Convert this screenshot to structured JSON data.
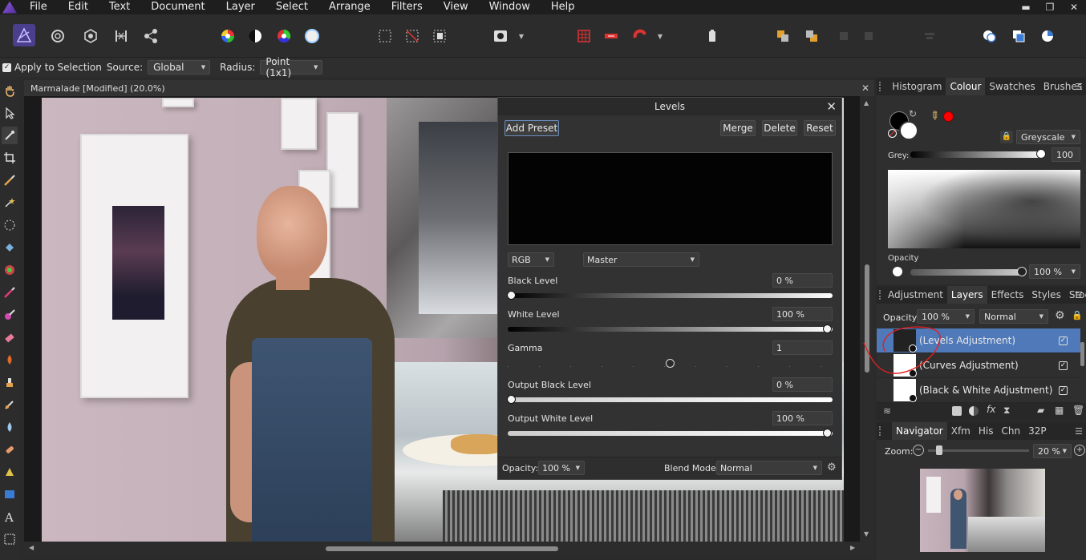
{
  "menu": {
    "items": [
      "File",
      "Edit",
      "Text",
      "Document",
      "Layer",
      "Select",
      "Arrange",
      "Filters",
      "View",
      "Window",
      "Help"
    ],
    "window_controls": {
      "minimize": "▬",
      "restore": "❐",
      "close": "✕"
    }
  },
  "context_bar": {
    "apply_to_selection": "Apply to Selection",
    "source_label": "Source:",
    "source_value": "Global",
    "radius_label": "Radius:",
    "radius_value": "Point (1x1)"
  },
  "document": {
    "title": "Marmalade [Modified] (20.0%)",
    "close": "✕"
  },
  "levels": {
    "title": "Levels",
    "add_preset": "Add Preset",
    "merge": "Merge",
    "delete": "Delete",
    "reset": "Reset",
    "channel": "RGB",
    "mode": "Master",
    "black_level": {
      "label": "Black Level",
      "value": "0 %",
      "fraction": 0.0
    },
    "white_level": {
      "label": "White Level",
      "value": "100 %",
      "fraction": 1.0
    },
    "gamma": {
      "label": "Gamma",
      "value": "1",
      "fraction": 0.5
    },
    "output_black": {
      "label": "Output Black Level",
      "value": "0 %",
      "fraction": 0.0
    },
    "output_white": {
      "label": "Output White Level",
      "value": "100 %",
      "fraction": 1.0
    },
    "opacity_label": "Opacity:",
    "opacity_value": "100 %",
    "blend_label": "Blend Mode:",
    "blend_value": "Normal"
  },
  "colour_panel": {
    "tabs": [
      "Histogram",
      "Colour",
      "Swatches",
      "Brushes"
    ],
    "active_tab": "Colour",
    "model": "Greyscale",
    "grey_label": "Grey:",
    "grey_value": "100",
    "opacity_label": "Opacity",
    "opacity_value": "100 %"
  },
  "layers_panel": {
    "tabs": [
      "Adjustment",
      "Layers",
      "Effects",
      "Styles",
      "Stock"
    ],
    "active_tab": "Layers",
    "opacity_label": "Opacity:",
    "opacity_value": "100 %",
    "blend_value": "Normal",
    "layers": [
      {
        "name": "(Levels Adjustment)",
        "selected": true
      },
      {
        "name": "(Curves Adjustment)",
        "selected": false
      },
      {
        "name": "(Black & White Adjustment)",
        "selected": false
      }
    ]
  },
  "navigator_panel": {
    "tabs": [
      "Navigator",
      "Xfm",
      "His",
      "Chn",
      "32P"
    ],
    "active_tab": "Navigator",
    "zoom_label": "Zoom:",
    "zoom_value": "20 %"
  },
  "colors": {
    "accent": "#4f79b8",
    "annotation": "#e02020",
    "foreground_colour": "#ff0000"
  }
}
